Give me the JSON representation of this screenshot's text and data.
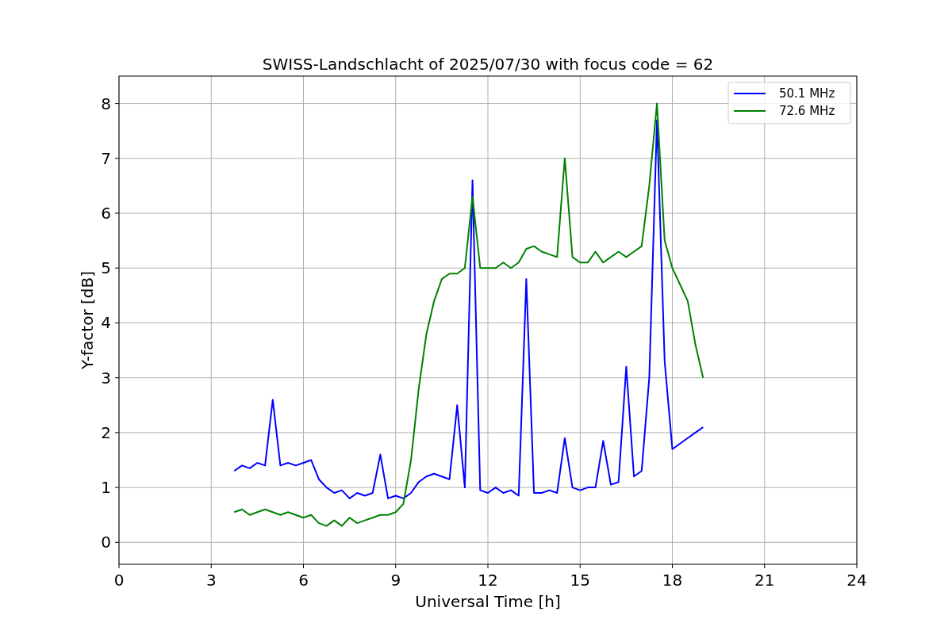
{
  "chart_data": {
    "type": "line",
    "title": "SWISS-Landschlacht of 2025/07/30 with focus code = 62",
    "xlabel": "Universal Time [h]",
    "ylabel": "Y-factor [dB]",
    "xlim": [
      0,
      24
    ],
    "ylim": [
      -0.4,
      8.5
    ],
    "xticks": [
      0,
      3,
      6,
      9,
      12,
      15,
      18,
      21,
      24
    ],
    "yticks": [
      0,
      1,
      2,
      3,
      4,
      5,
      6,
      7,
      8
    ],
    "grid": true,
    "legend": "upper right",
    "x": [
      3.75,
      4,
      4.25,
      4.5,
      4.75,
      5,
      5.25,
      5.5,
      5.75,
      6,
      6.25,
      6.5,
      6.75,
      7,
      7.25,
      7.5,
      7.75,
      8,
      8.25,
      8.5,
      8.75,
      9,
      9.25,
      9.5,
      9.75,
      10,
      10.25,
      10.5,
      10.75,
      11,
      11.25,
      11.5,
      11.75,
      12,
      12.25,
      12.5,
      12.75,
      13,
      13.25,
      13.5,
      13.75,
      14,
      14.25,
      14.5,
      14.75,
      15,
      15.25,
      15.5,
      15.75,
      16,
      16.25,
      16.5,
      16.75,
      17,
      17.25,
      17.5,
      17.75,
      18,
      18.25,
      18.5,
      18.75,
      19
    ],
    "series": [
      {
        "name": "50.1 MHz",
        "color": "#0000ff",
        "values": [
          1.3,
          1.4,
          1.35,
          1.45,
          1.4,
          2.6,
          1.4,
          1.45,
          1.4,
          1.45,
          1.5,
          1.15,
          1.0,
          0.9,
          0.95,
          0.8,
          0.9,
          0.85,
          0.9,
          1.6,
          0.8,
          0.85,
          0.8,
          0.9,
          1.1,
          1.2,
          1.25,
          1.2,
          1.15,
          2.5,
          1.0,
          6.6,
          0.95,
          0.9,
          1.0,
          0.9,
          0.95,
          0.85,
          4.8,
          0.9,
          0.9,
          0.95,
          0.9,
          1.9,
          1.0,
          0.95,
          1.0,
          1.0,
          1.85,
          1.05,
          1.1,
          3.2,
          1.2,
          1.3,
          3.0,
          7.7,
          3.3,
          1.7,
          1.8,
          1.9,
          2.0,
          2.1
        ]
      },
      {
        "name": "72.6 MHz",
        "color": "#008000",
        "values": [
          0.55,
          0.6,
          0.5,
          0.55,
          0.6,
          0.55,
          0.5,
          0.55,
          0.5,
          0.45,
          0.5,
          0.35,
          0.3,
          0.4,
          0.3,
          0.45,
          0.35,
          0.4,
          0.45,
          0.5,
          0.5,
          0.55,
          0.7,
          1.5,
          2.8,
          3.8,
          4.4,
          4.8,
          4.9,
          4.9,
          5.0,
          6.3,
          5.0,
          5.0,
          5.0,
          5.1,
          5.0,
          5.1,
          5.35,
          5.4,
          5.3,
          5.25,
          5.2,
          7.0,
          5.2,
          5.1,
          5.1,
          5.3,
          5.1,
          5.2,
          5.3,
          5.2,
          5.3,
          5.4,
          6.5,
          8.0,
          5.5,
          5.0,
          4.7,
          4.4,
          3.6,
          3.0
        ]
      }
    ]
  }
}
